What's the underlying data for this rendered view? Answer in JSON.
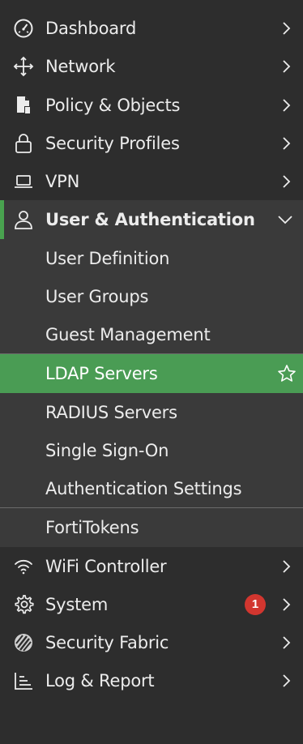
{
  "colors": {
    "background": "#2d2d2d",
    "submenu_background": "#3a3a3a",
    "active_green": "#4a9c54",
    "accent_green": "#49a24f",
    "badge_red": "#d2362f",
    "text": "#ececec"
  },
  "menu": {
    "dashboard": {
      "label": "Dashboard",
      "icon": "dashboard-gauge-icon"
    },
    "network": {
      "label": "Network",
      "icon": "network-move-icon"
    },
    "policy": {
      "label": "Policy & Objects",
      "icon": "policy-document-icon"
    },
    "security_profiles": {
      "label": "Security Profiles",
      "icon": "lock-icon"
    },
    "vpn": {
      "label": "VPN",
      "icon": "laptop-icon"
    },
    "user_auth": {
      "label": "User & Authentication",
      "icon": "user-icon",
      "expanded": true,
      "children": {
        "user_definition": "User Definition",
        "user_groups": "User Groups",
        "guest_management": "Guest Management",
        "ldap_servers": "LDAP Servers",
        "radius_servers": "RADIUS Servers",
        "single_sign_on": "Single Sign-On",
        "authentication_settings": "Authentication Settings",
        "fortitokens": "FortiTokens"
      },
      "active_child": "LDAP Servers"
    },
    "wifi": {
      "label": "WiFi Controller",
      "icon": "wifi-icon"
    },
    "system": {
      "label": "System",
      "icon": "gear-icon",
      "badge": "1"
    },
    "security_fabric": {
      "label": "Security Fabric",
      "icon": "security-fabric-icon"
    },
    "log_report": {
      "label": "Log & Report",
      "icon": "log-report-chart-icon"
    }
  }
}
